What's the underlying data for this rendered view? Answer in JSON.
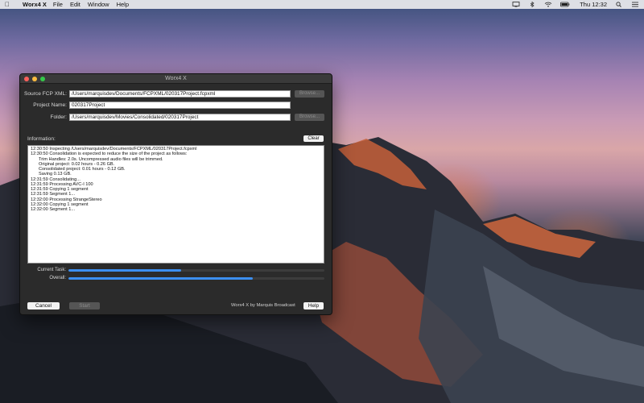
{
  "menubar": {
    "app_name": "Worx4 X",
    "items": [
      "File",
      "Edit",
      "Window",
      "Help"
    ],
    "clock": "Thu 12:32"
  },
  "window": {
    "title": "Worx4 X",
    "source_label": "Source FCP XML:",
    "source_value": "/Users/marquisdev/Documents/FCPXML/020317Project.fcpxml",
    "project_label": "Project Name:",
    "project_value": "020317Project",
    "folder_label": "Folder:",
    "folder_value": "/Users/marquisdev/Movies/Consolidated/020317Project",
    "browse_label": "Browse...",
    "info_label": "Information:",
    "clear_label": "Clear",
    "log": [
      {
        "text": "12:30:50  Inspecting /Users/marquisdev/Documents/FCPXML/020317Project.fcpxml",
        "indent": false
      },
      {
        "text": "12:30:50  Consolidation is expected to reduce the size of the project as follows:",
        "indent": false
      },
      {
        "text": "Trim Handles: 2.0s. Uncompressed audio files will be trimmed.",
        "indent": true
      },
      {
        "text": "Original project: 0.02 hours - 0.26 GB.",
        "indent": true
      },
      {
        "text": "Consolidated project: 0.01 hours - 0.12 GB.",
        "indent": true
      },
      {
        "text": "Saving 0.13 GB.",
        "indent": true
      },
      {
        "text": "12:31:59  Consolidating...",
        "indent": false
      },
      {
        "text": "12:31:59  Processing AVC-I 100",
        "indent": false
      },
      {
        "text": "12:31:59  Copying 1 segment",
        "indent": false
      },
      {
        "text": "12:31:59  Segment 1...",
        "indent": false
      },
      {
        "text": "12:32:00  Processing StrangeStereo",
        "indent": false
      },
      {
        "text": "12:32:00  Copying 1 segment",
        "indent": false
      },
      {
        "text": "12:32:00  Segment 1...",
        "indent": false
      }
    ],
    "current_task_label": "Current Task:",
    "current_task_progress": 0.44,
    "overall_label": "Overall:",
    "overall_progress": 0.72,
    "cancel_label": "Cancel",
    "start_label": "Start",
    "credit": "Worx4 X by Marquis Broadcast",
    "help_label": "Help"
  },
  "colors": {
    "accent": "#3c8ff0",
    "window_bg": "#2b2b2b"
  }
}
